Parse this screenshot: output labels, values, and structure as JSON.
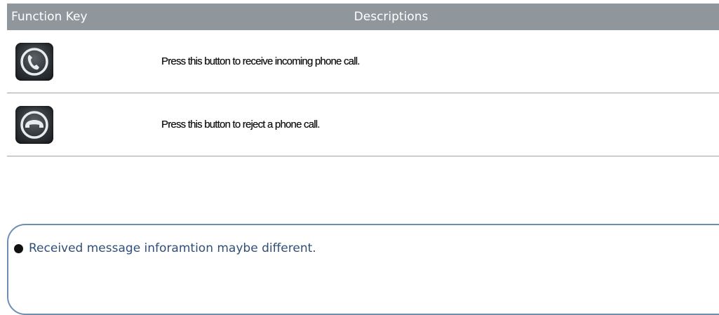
{
  "table": {
    "header": {
      "key_label": "Function Key",
      "desc_label": "Descriptions"
    },
    "rows": [
      {
        "icon": "answer-call-icon",
        "description": "Press this button to receive incoming phone call."
      },
      {
        "icon": "reject-call-icon",
        "description": "Press this button to reject a phone call."
      }
    ]
  },
  "note": {
    "text": "Received message inforamtion maybe different."
  },
  "colors": {
    "header_bg": "#8f969c",
    "note_border": "#6d8fb3",
    "note_text": "#2f4f78"
  }
}
